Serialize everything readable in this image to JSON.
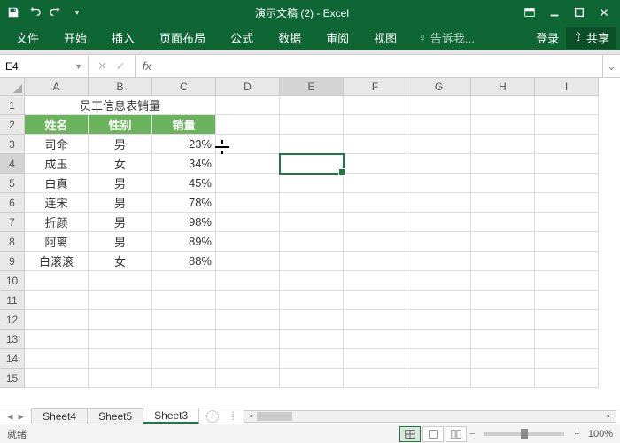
{
  "app": {
    "title": "演示文稿 (2) - Excel"
  },
  "qat": {
    "save": "save-icon",
    "undo": "undo-icon",
    "redo": "redo-icon"
  },
  "ribbon": {
    "file": "文件",
    "home": "开始",
    "insert": "插入",
    "layout": "页面布局",
    "formulas": "公式",
    "data": "数据",
    "review": "审阅",
    "view": "视图",
    "tellme": "告诉我...",
    "signin": "登录",
    "share": "共享"
  },
  "namebox": {
    "ref": "E4"
  },
  "formula": {
    "value": ""
  },
  "columns": [
    "A",
    "B",
    "C",
    "D",
    "E",
    "F",
    "G",
    "H",
    "I"
  ],
  "rows_visible": 15,
  "table": {
    "title": "员工信息表销量",
    "headers": {
      "name": "姓名",
      "gender": "性别",
      "sales": "销量"
    },
    "rows": [
      {
        "name": "司命",
        "gender": "男",
        "sales": "23%"
      },
      {
        "name": "成玉",
        "gender": "女",
        "sales": "34%"
      },
      {
        "name": "白真",
        "gender": "男",
        "sales": "45%"
      },
      {
        "name": "连宋",
        "gender": "男",
        "sales": "78%"
      },
      {
        "name": "折颜",
        "gender": "男",
        "sales": "98%"
      },
      {
        "name": "阿离",
        "gender": "男",
        "sales": "89%"
      },
      {
        "name": "白滚滚",
        "gender": "女",
        "sales": "88%"
      }
    ]
  },
  "selection": {
    "col": "E",
    "row": 4
  },
  "sheets": {
    "list": [
      "Sheet4",
      "Sheet5",
      "Sheet3"
    ],
    "active": "Sheet3"
  },
  "status": {
    "ready": "就绪",
    "zoom": "100%"
  }
}
